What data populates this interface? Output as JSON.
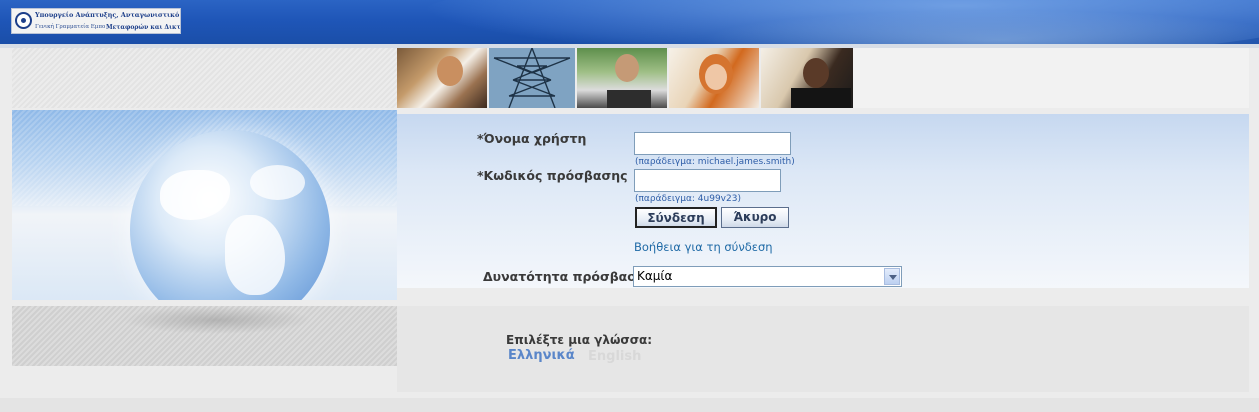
{
  "header": {
    "logo_line1": "Υπουργείο Ανάπτυξης, Ανταγωνιστικότητας, Υποδομών,",
    "logo_line2_left": "Γενική Γραμματεία Εμπορίου",
    "logo_line2_right": "Μεταφορών και Δικτύων"
  },
  "login": {
    "username_label": "*Όνομα χρήστη",
    "username_value": "",
    "username_hint": "(παράδειγμα: michael.james.smith)",
    "password_label": "*Κωδικός πρόσβασης",
    "password_value": "",
    "password_hint": "(παράδειγμα: 4u99v23)",
    "login_button": "Σύνδεση",
    "cancel_button": "Άκυρο",
    "help_link": "Βοήθεια για τη σύνδεση",
    "accessibility_label": "Δυνατότητα πρόσβασης",
    "accessibility_value": "Καμία"
  },
  "language": {
    "prompt": "Επιλέξτε μια γλώσσα:",
    "greek": "Ελληνικά",
    "english": "English"
  },
  "colors": {
    "header_blue": "#1f56b8",
    "link_blue": "#1f6aa6",
    "hint_blue": "#2f5ea8"
  }
}
